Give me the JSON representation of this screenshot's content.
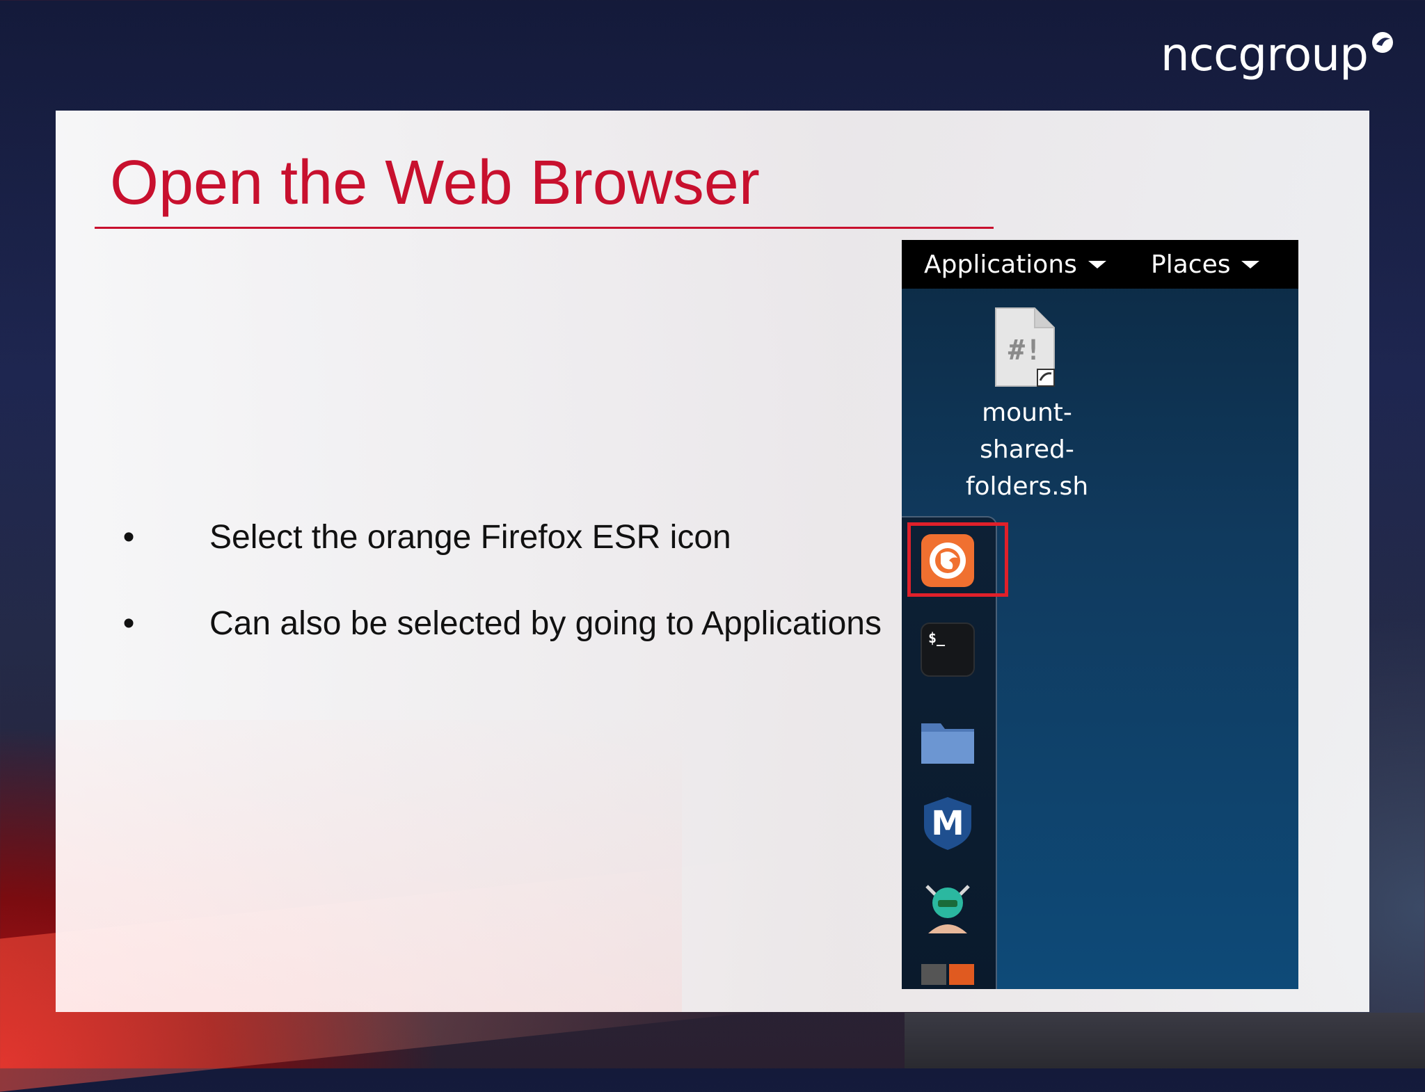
{
  "brand": {
    "logo_text": "nccgroup"
  },
  "slide": {
    "title": "Open the Web Browser",
    "bullets": [
      {
        "marker": "•",
        "text": "Select the orange Firefox ESR icon"
      },
      {
        "marker": "•",
        "text": "Can also be selected by going to Applications"
      }
    ]
  },
  "desktop": {
    "topbar": {
      "applications_label": "Applications",
      "places_label": "Places"
    },
    "desktop_file": {
      "label_lines": [
        "mount-",
        "shared-",
        "folders.sh"
      ],
      "icon_glyph": "#!",
      "icon": "script-file-icon"
    },
    "dock": [
      {
        "icon": "firefox-esr-icon",
        "highlighted": true
      },
      {
        "icon": "terminal-icon",
        "glyph": "$_"
      },
      {
        "icon": "files-folder-icon"
      },
      {
        "icon": "metasploit-icon",
        "glyph": "M"
      },
      {
        "icon": "armitage-icon"
      },
      {
        "icon": "partial-app-icon"
      }
    ],
    "highlight_color": "#e0202a"
  },
  "colors": {
    "title_red": "#c8102e",
    "firefox_orange": "#f07030"
  }
}
